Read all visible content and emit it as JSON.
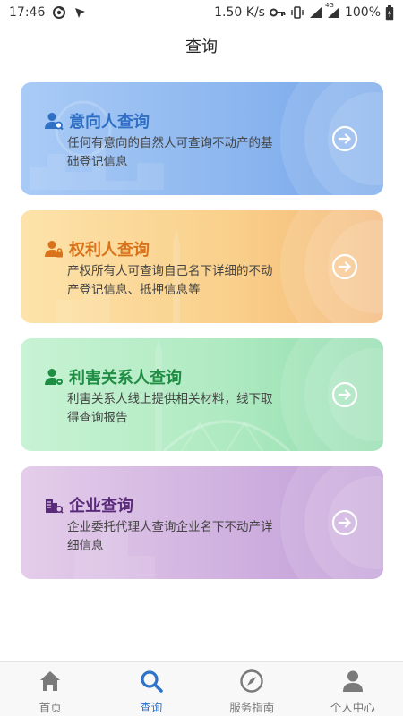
{
  "status_bar": {
    "time": "17:46",
    "speed": "1.50 K/s",
    "network": "4G",
    "battery": "100%",
    "icons": [
      "app-notification-icon",
      "navigation-arrow-icon",
      "key-icon",
      "vibrate-icon",
      "signal-icon",
      "signal-4g-icon",
      "battery-icon"
    ]
  },
  "page": {
    "title": "查询"
  },
  "cards": [
    {
      "title": "意向人查询",
      "description": "任何有意向的自然人可查询不动产的基础登记信息",
      "icon": "user-search-icon",
      "color": "#2f6fc4"
    },
    {
      "title": "权利人查询",
      "description": "产权所有人可查询自己名下详细的不动产登记信息、抵押信息等",
      "icon": "user-lock-icon",
      "color": "#d9731b"
    },
    {
      "title": "利害关系人查询",
      "description": "利害关系人线上提供相关材料，线下取得查询报告",
      "icon": "user-link-icon",
      "color": "#1f8e44"
    },
    {
      "title": "企业查询",
      "description": "企业委托代理人查询企业名下不动产详细信息",
      "icon": "building-search-icon",
      "color": "#5a2a7a"
    }
  ],
  "tabbar": {
    "items": [
      {
        "label": "首页",
        "icon": "home-icon",
        "active": false
      },
      {
        "label": "查询",
        "icon": "search-icon",
        "active": true
      },
      {
        "label": "服务指南",
        "icon": "compass-icon",
        "active": false
      },
      {
        "label": "个人中心",
        "icon": "person-icon",
        "active": false
      }
    ],
    "active_color": "#2f73c9",
    "inactive_color": "#777777"
  }
}
